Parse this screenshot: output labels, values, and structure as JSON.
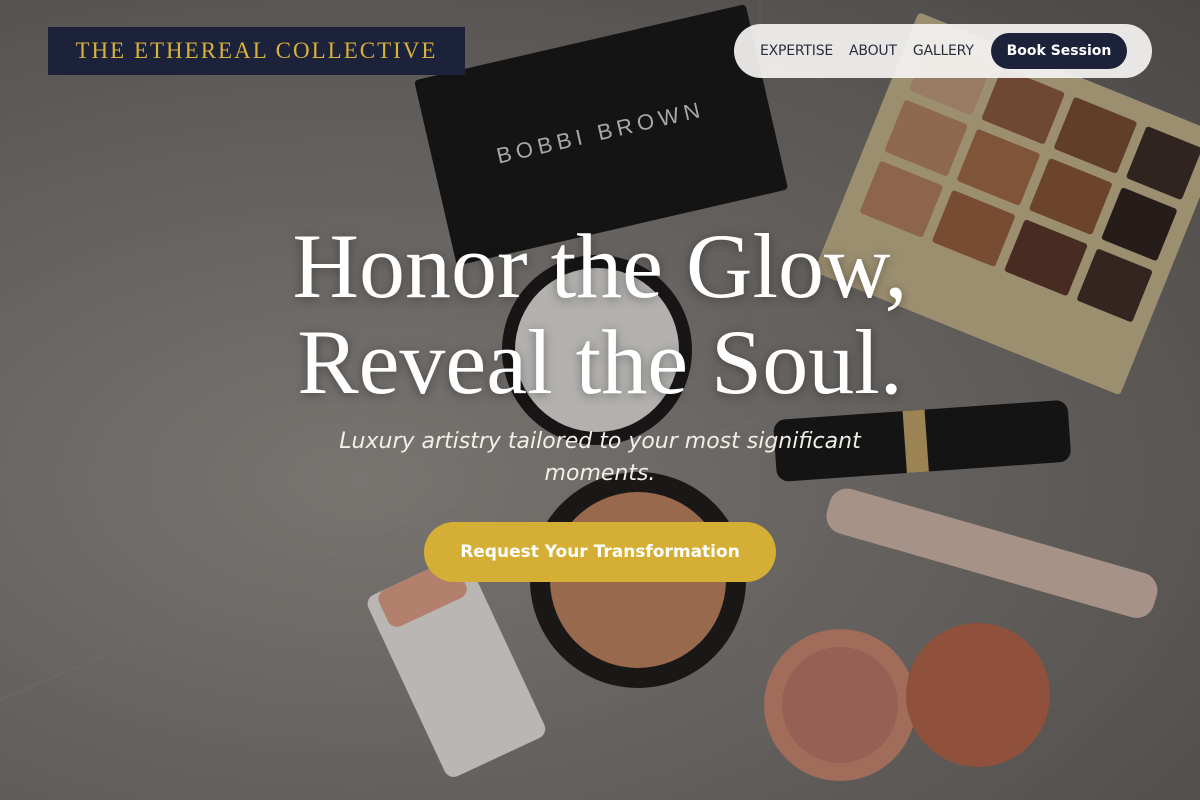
{
  "brand": {
    "name": "THE ETHEREAL COLLECTIVE"
  },
  "nav": {
    "items": [
      {
        "label": "EXPERTISE"
      },
      {
        "label": "ABOUT"
      },
      {
        "label": "GALLERY"
      }
    ],
    "cta_label": "Book Session"
  },
  "hero": {
    "headline_line1": "Honor the Glow,",
    "headline_line2": "Reveal the Soul.",
    "subtitle": "Luxury artistry tailored to your most significant moments.",
    "cta_label": "Request Your Transformation",
    "background_image": "makeup-flatlay-photo",
    "compact_brand_text": "BOBBI BROWN"
  },
  "colors": {
    "brand_bg": "#1b2239",
    "brand_text": "#d9b13d",
    "accent_gold": "#d5af35",
    "nav_bg": "#f5f4f2",
    "headline": "#ffffff"
  }
}
